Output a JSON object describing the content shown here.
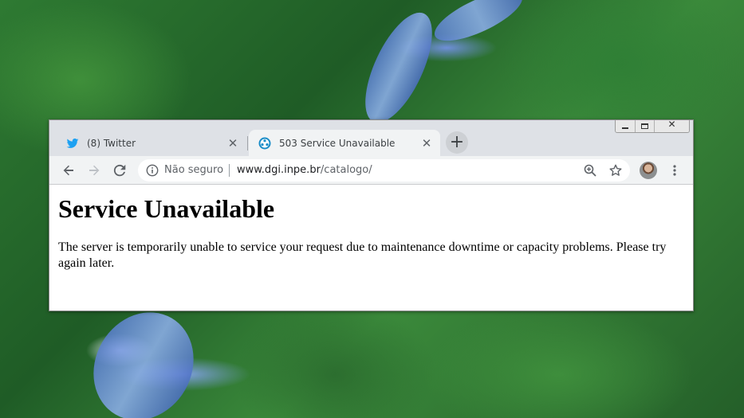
{
  "tabs": [
    {
      "title": "(8) Twitter",
      "icon": "twitter-bird-icon",
      "active": false
    },
    {
      "title": "503 Service Unavailable",
      "icon": "globe-icon",
      "active": true
    }
  ],
  "toolbar": {
    "security_label": "Não seguro",
    "url_host": "www.dgi.inpe.br",
    "url_path": "/catalogo/"
  },
  "page": {
    "heading": "Service Unavailable",
    "message": "The server is temporarily unable to service your request due to maintenance downtime or capacity problems. Please try again later."
  },
  "colors": {
    "twitter_blue": "#1da1f2",
    "globe_blue": "#1a8dc8",
    "tabstrip_bg": "#dee1e6",
    "toolbar_bg": "#f1f3f4"
  }
}
